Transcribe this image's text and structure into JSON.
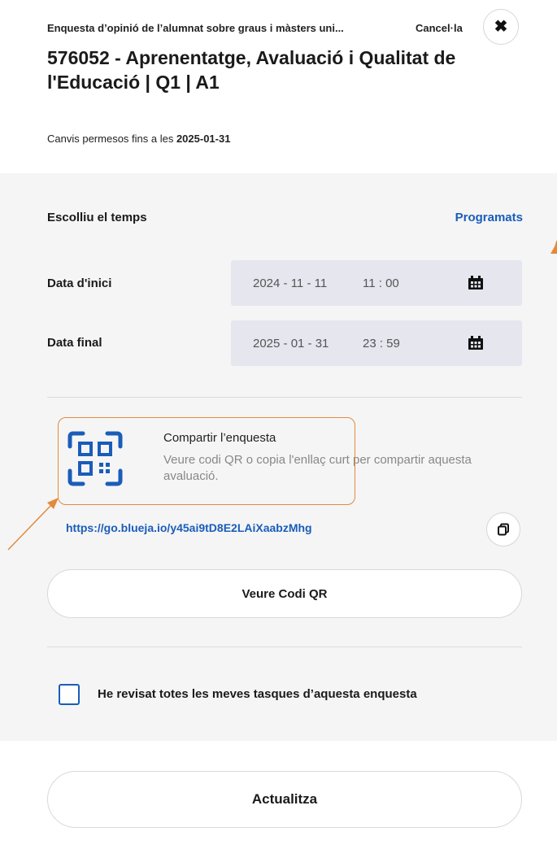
{
  "header": {
    "subtitle": "Enquesta d’opinió de l’alumnat sobre graus i màsters uni...",
    "cancel_label": "Cancel·la",
    "close_icon": "close-icon",
    "title": "576052 - Aprenentatge, Avaluació i Qualitat de l'Educació | Q1 | A1"
  },
  "changes": {
    "prefix": "Canvis permesos fins a les ",
    "date": "2025-01-31"
  },
  "schedule": {
    "heading": "Escolliu el temps",
    "scheduled_link": "Programats",
    "start": {
      "label": "Data d'inici",
      "date": "2024 - 11 - 11",
      "time": "11 : 00",
      "icon": "calendar-icon"
    },
    "end": {
      "label": "Data final",
      "date": "2025 - 01 - 31",
      "time": "23 : 59",
      "icon": "calendar-icon"
    }
  },
  "share": {
    "icon": "qr-code-icon",
    "title": "Compartir l’enquesta",
    "description": "Veure codi QR o copia l'enllaç curt per compartir aquesta avaluació.",
    "short_link": "https://go.blueja.io/y45ai9tD8E2LAiXaabzMhg",
    "copy_icon": "copy-icon",
    "qr_button_label": "Veure Codi QR"
  },
  "confirmation": {
    "checkbox_checked": false,
    "label": "He revisat totes les meves tasques d’aquesta enquesta"
  },
  "footer": {
    "update_label": "Actualitza"
  },
  "colors": {
    "accent": "#1a5db8",
    "highlight": "#e38b3a",
    "panel_bg": "#f5f5f6",
    "field_bg": "#e5e6ee"
  }
}
